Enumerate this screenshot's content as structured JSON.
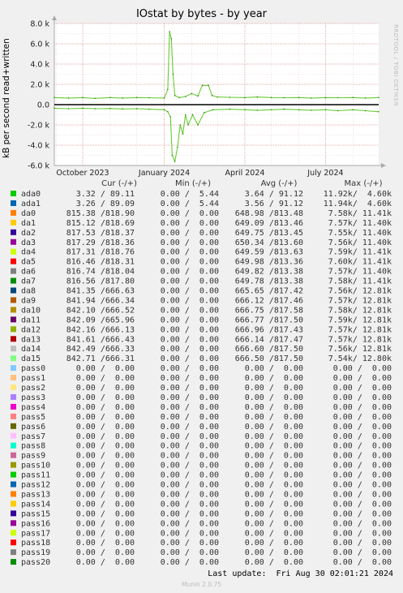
{
  "title": "IOstat by bytes - by year",
  "y_axis_label": "kB per second read+written",
  "side_label": "RRDTOOL / TOBI OETIKER",
  "chart_data": {
    "type": "line",
    "ylim": [
      -6000,
      8000
    ],
    "yticks": [
      {
        "value": 8000,
        "label": "8.0 k"
      },
      {
        "value": 6000,
        "label": "6.0 k"
      },
      {
        "value": 4000,
        "label": "4.0 k"
      },
      {
        "value": 2000,
        "label": "2.0 k"
      },
      {
        "value": 0,
        "label": "0.0"
      },
      {
        "value": -2000,
        "label": "-2.0 k"
      },
      {
        "value": -4000,
        "label": "-4.0 k"
      },
      {
        "value": -6000,
        "label": "-6.0 k"
      }
    ],
    "xlim": [
      "2023-08-30",
      "2024-08-30"
    ],
    "xticks": [
      {
        "date": "2023-10-01",
        "label": "October 2023"
      },
      {
        "date": "2024-01-01",
        "label": "January 2024"
      },
      {
        "date": "2024-04-01",
        "label": "April 2024"
      },
      {
        "date": "2024-07-01",
        "label": "July 2024"
      }
    ],
    "grid": true,
    "series_color": "#66cc33",
    "written": [
      [
        "2023-08-30",
        700
      ],
      [
        "2023-09-15",
        650
      ],
      [
        "2023-10-01",
        700
      ],
      [
        "2023-10-15",
        620
      ],
      [
        "2023-11-01",
        700
      ],
      [
        "2023-11-15",
        650
      ],
      [
        "2023-12-01",
        700
      ],
      [
        "2023-12-15",
        680
      ],
      [
        "2024-01-01",
        650
      ],
      [
        "2024-01-05",
        1500
      ],
      [
        "2024-01-07",
        7200
      ],
      [
        "2024-01-09",
        6500
      ],
      [
        "2024-01-11",
        3000
      ],
      [
        "2024-01-13",
        900
      ],
      [
        "2024-01-18",
        700
      ],
      [
        "2024-01-25",
        800
      ],
      [
        "2024-02-01",
        1100
      ],
      [
        "2024-02-08",
        850
      ],
      [
        "2024-02-13",
        1900
      ],
      [
        "2024-02-20",
        1900
      ],
      [
        "2024-02-24",
        900
      ],
      [
        "2024-03-01",
        750
      ],
      [
        "2024-03-15",
        720
      ],
      [
        "2024-04-01",
        700
      ],
      [
        "2024-04-15",
        750
      ],
      [
        "2024-05-01",
        700
      ],
      [
        "2024-05-15",
        680
      ],
      [
        "2024-06-01",
        700
      ],
      [
        "2024-06-15",
        650
      ],
      [
        "2024-07-01",
        700
      ],
      [
        "2024-07-15",
        680
      ],
      [
        "2024-08-01",
        700
      ],
      [
        "2024-08-15",
        650
      ],
      [
        "2024-08-30",
        700
      ]
    ],
    "read": [
      [
        "2023-08-30",
        -350
      ],
      [
        "2023-09-15",
        -400
      ],
      [
        "2023-10-01",
        -350
      ],
      [
        "2023-10-15",
        -400
      ],
      [
        "2023-11-01",
        -380
      ],
      [
        "2023-11-15",
        -420
      ],
      [
        "2023-12-01",
        -400
      ],
      [
        "2023-12-15",
        -450
      ],
      [
        "2024-01-01",
        -500
      ],
      [
        "2024-01-05",
        -700
      ],
      [
        "2024-01-08",
        -1200
      ],
      [
        "2024-01-10",
        -5000
      ],
      [
        "2024-01-13",
        -5600
      ],
      [
        "2024-01-16",
        -4200
      ],
      [
        "2024-01-19",
        -2000
      ],
      [
        "2024-01-22",
        -2900
      ],
      [
        "2024-01-25",
        -1000
      ],
      [
        "2024-01-28",
        -2000
      ],
      [
        "2024-02-02",
        -1000
      ],
      [
        "2024-02-08",
        -2000
      ],
      [
        "2024-02-15",
        -800
      ],
      [
        "2024-02-25",
        -500
      ],
      [
        "2024-03-15",
        -450
      ],
      [
        "2024-04-01",
        -500
      ],
      [
        "2024-04-15",
        -550
      ],
      [
        "2024-05-01",
        -500
      ],
      [
        "2024-05-15",
        -450
      ],
      [
        "2024-06-01",
        -500
      ],
      [
        "2024-06-15",
        -550
      ],
      [
        "2024-07-01",
        -500
      ],
      [
        "2024-07-15",
        -600
      ],
      [
        "2024-08-01",
        -500
      ],
      [
        "2024-08-15",
        -600
      ],
      [
        "2024-08-30",
        -700
      ]
    ]
  },
  "legend": {
    "header": {
      "cur": "Cur (-/+)",
      "min": "Min (-/+)",
      "avg": "Avg (-/+)",
      "max": "Max (-/+)"
    },
    "rows": [
      {
        "name": "ada0",
        "color": "#00cc00",
        "cur": "3.32 / 89.11",
        "min": "0.00 /  5.44",
        "avg": "3.64 / 91.12",
        "max": "11.92k/  4.60k"
      },
      {
        "name": "ada1",
        "color": "#0066b3",
        "cur": "3.26 / 89.09",
        "min": "0.00 /  5.44",
        "avg": "3.56 / 91.12",
        "max": "11.94k/  4.60k"
      },
      {
        "name": "da0",
        "color": "#ff8000",
        "cur": "815.38 /818.90",
        "min": "0.00 /  0.00",
        "avg": "648.98 /813.48",
        "max": "7.58k/ 11.41k"
      },
      {
        "name": "da1",
        "color": "#ffcc00",
        "cur": "815.12 /818.69",
        "min": "0.00 /  0.00",
        "avg": "649.09 /813.46",
        "max": "7.57k/ 11.40k"
      },
      {
        "name": "da2",
        "color": "#330099",
        "cur": "817.53 /818.37",
        "min": "0.00 /  0.00",
        "avg": "649.75 /813.45",
        "max": "7.55k/ 11.40k"
      },
      {
        "name": "da3",
        "color": "#990099",
        "cur": "817.29 /818.36",
        "min": "0.00 /  0.00",
        "avg": "650.34 /813.60",
        "max": "7.56k/ 11.40k"
      },
      {
        "name": "da4",
        "color": "#ccff00",
        "cur": "817.31 /818.76",
        "min": "0.00 /  0.00",
        "avg": "649.59 /813.63",
        "max": "7.59k/ 11.41k"
      },
      {
        "name": "da5",
        "color": "#ff0000",
        "cur": "816.46 /818.31",
        "min": "0.00 /  0.00",
        "avg": "649.98 /813.36",
        "max": "7.60k/ 11.41k"
      },
      {
        "name": "da6",
        "color": "#808080",
        "cur": "816.74 /818.04",
        "min": "0.00 /  0.00",
        "avg": "649.82 /813.38",
        "max": "7.57k/ 11.40k"
      },
      {
        "name": "da7",
        "color": "#008f00",
        "cur": "816.56 /817.80",
        "min": "0.00 /  0.00",
        "avg": "649.78 /813.38",
        "max": "7.58k/ 11.41k"
      },
      {
        "name": "da8",
        "color": "#00487d",
        "cur": "841.35 /666.63",
        "min": "0.00 /  0.00",
        "avg": "665.65 /817.42",
        "max": "7.56k/ 12.81k"
      },
      {
        "name": "da9",
        "color": "#b35a00",
        "cur": "841.94 /666.34",
        "min": "0.00 /  0.00",
        "avg": "666.12 /817.46",
        "max": "7.57k/ 12.81k"
      },
      {
        "name": "da10",
        "color": "#b38f00",
        "cur": "842.10 /666.52",
        "min": "0.00 /  0.00",
        "avg": "666.75 /817.58",
        "max": "7.58k/ 12.81k"
      },
      {
        "name": "da11",
        "color": "#6b006b",
        "cur": "842.09 /665.96",
        "min": "0.00 /  0.00",
        "avg": "666.77 /817.50",
        "max": "7.59k/ 12.81k"
      },
      {
        "name": "da12",
        "color": "#8fb300",
        "cur": "842.16 /666.13",
        "min": "0.00 /  0.00",
        "avg": "666.96 /817.43",
        "max": "7.57k/ 12.81k"
      },
      {
        "name": "da13",
        "color": "#b30000",
        "cur": "841.61 /666.43",
        "min": "0.00 /  0.00",
        "avg": "666.14 /817.47",
        "max": "7.57k/ 12.81k"
      },
      {
        "name": "da14",
        "color": "#bebebe",
        "cur": "842.49 /666.33",
        "min": "0.00 /  0.00",
        "avg": "666.60 /817.50",
        "max": "7.56k/ 12.81k"
      },
      {
        "name": "da15",
        "color": "#80ff80",
        "cur": "842.71 /666.31",
        "min": "0.00 /  0.00",
        "avg": "666.50 /817.50",
        "max": "7.54k/ 12.80k"
      },
      {
        "name": "pass0",
        "color": "#80c9ff",
        "cur": "0.00 /  0.00",
        "min": "0.00 /  0.00",
        "avg": "0.00 /  0.00",
        "max": "0.00 /  0.00"
      },
      {
        "name": "pass1",
        "color": "#ffc080",
        "cur": "0.00 /  0.00",
        "min": "0.00 /  0.00",
        "avg": "0.00 /  0.00",
        "max": "0.00 /  0.00"
      },
      {
        "name": "pass2",
        "color": "#ffe680",
        "cur": "0.00 /  0.00",
        "min": "0.00 /  0.00",
        "avg": "0.00 /  0.00",
        "max": "0.00 /  0.00"
      },
      {
        "name": "pass3",
        "color": "#aa80ff",
        "cur": "0.00 /  0.00",
        "min": "0.00 /  0.00",
        "avg": "0.00 /  0.00",
        "max": "0.00 /  0.00"
      },
      {
        "name": "pass4",
        "color": "#ee00cc",
        "cur": "0.00 /  0.00",
        "min": "0.00 /  0.00",
        "avg": "0.00 /  0.00",
        "max": "0.00 /  0.00"
      },
      {
        "name": "pass5",
        "color": "#ff8080",
        "cur": "0.00 /  0.00",
        "min": "0.00 /  0.00",
        "avg": "0.00 /  0.00",
        "max": "0.00 /  0.00"
      },
      {
        "name": "pass6",
        "color": "#666600",
        "cur": "0.00 /  0.00",
        "min": "0.00 /  0.00",
        "avg": "0.00 /  0.00",
        "max": "0.00 /  0.00"
      },
      {
        "name": "pass7",
        "color": "#ffbfff",
        "cur": "0.00 /  0.00",
        "min": "0.00 /  0.00",
        "avg": "0.00 /  0.00",
        "max": "0.00 /  0.00"
      },
      {
        "name": "pass8",
        "color": "#00ffcc",
        "cur": "0.00 /  0.00",
        "min": "0.00 /  0.00",
        "avg": "0.00 /  0.00",
        "max": "0.00 /  0.00"
      },
      {
        "name": "pass9",
        "color": "#cc6699",
        "cur": "0.00 /  0.00",
        "min": "0.00 /  0.00",
        "avg": "0.00 /  0.00",
        "max": "0.00 /  0.00"
      },
      {
        "name": "pass10",
        "color": "#999900",
        "cur": "0.00 /  0.00",
        "min": "0.00 /  0.00",
        "avg": "0.00 /  0.00",
        "max": "0.00 /  0.00"
      },
      {
        "name": "pass11",
        "color": "#00cc00",
        "cur": "0.00 /  0.00",
        "min": "0.00 /  0.00",
        "avg": "0.00 /  0.00",
        "max": "0.00 /  0.00"
      },
      {
        "name": "pass12",
        "color": "#0066b3",
        "cur": "0.00 /  0.00",
        "min": "0.00 /  0.00",
        "avg": "0.00 /  0.00",
        "max": "0.00 /  0.00"
      },
      {
        "name": "pass13",
        "color": "#ff8000",
        "cur": "0.00 /  0.00",
        "min": "0.00 /  0.00",
        "avg": "0.00 /  0.00",
        "max": "0.00 /  0.00"
      },
      {
        "name": "pass14",
        "color": "#ffcc00",
        "cur": "0.00 /  0.00",
        "min": "0.00 /  0.00",
        "avg": "0.00 /  0.00",
        "max": "0.00 /  0.00"
      },
      {
        "name": "pass15",
        "color": "#330099",
        "cur": "0.00 /  0.00",
        "min": "0.00 /  0.00",
        "avg": "0.00 /  0.00",
        "max": "0.00 /  0.00"
      },
      {
        "name": "pass16",
        "color": "#990099",
        "cur": "0.00 /  0.00",
        "min": "0.00 /  0.00",
        "avg": "0.00 /  0.00",
        "max": "0.00 /  0.00"
      },
      {
        "name": "pass17",
        "color": "#ccff00",
        "cur": "0.00 /  0.00",
        "min": "0.00 /  0.00",
        "avg": "0.00 /  0.00",
        "max": "0.00 /  0.00"
      },
      {
        "name": "pass18",
        "color": "#ff0000",
        "cur": "0.00 /  0.00",
        "min": "0.00 /  0.00",
        "avg": "0.00 /  0.00",
        "max": "0.00 /  0.00"
      },
      {
        "name": "pass19",
        "color": "#808080",
        "cur": "0.00 /  0.00",
        "min": "0.00 /  0.00",
        "avg": "0.00 /  0.00",
        "max": "0.00 /  0.00"
      },
      {
        "name": "pass20",
        "color": "#008f00",
        "cur": "0.00 /  0.00",
        "min": "0.00 /  0.00",
        "avg": "0.00 /  0.00",
        "max": "0.00 /  0.00"
      }
    ]
  },
  "last_update": "Last update:  Fri Aug 30 02:01:21 2024",
  "munin_version": "Munin 2.0.75"
}
